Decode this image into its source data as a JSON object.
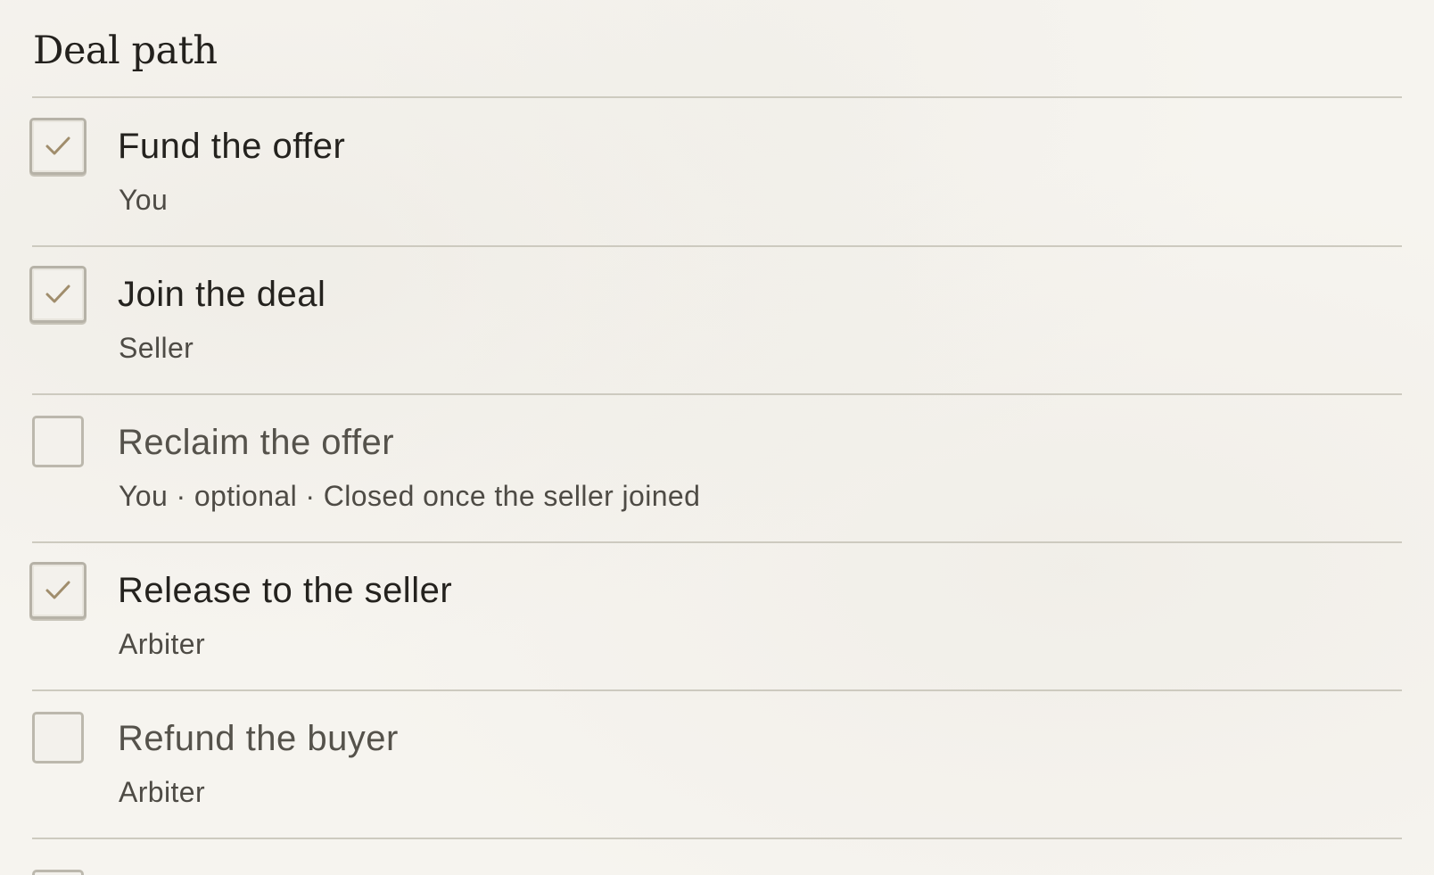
{
  "panel": {
    "title": "Deal path"
  },
  "colors": {
    "check_mark": "#a08d6c",
    "rule": "#cdcabf",
    "background": "#f6f4ef"
  },
  "steps": [
    {
      "title": "Fund the offer",
      "meta": "You",
      "checked": true
    },
    {
      "title": "Join the deal",
      "meta": "Seller",
      "checked": true
    },
    {
      "title": "Reclaim the offer",
      "meta": "You · optional · Closed once the seller joined",
      "checked": false
    },
    {
      "title": "Release to the seller",
      "meta": "Arbiter",
      "checked": true
    },
    {
      "title": "Refund the buyer",
      "meta": "Arbiter",
      "checked": false
    }
  ]
}
